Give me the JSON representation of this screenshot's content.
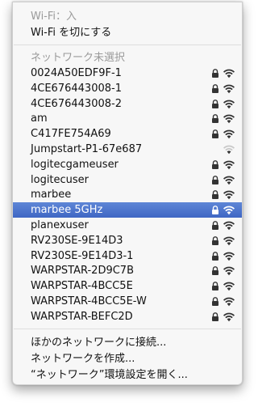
{
  "status": {
    "wifi_status": "Wi-Fi：入",
    "turn_off": "Wi-Fi を切にする"
  },
  "networks_header": "ネットワーク未選択",
  "networks": [
    {
      "name": "0024A50EDF9F-1",
      "locked": true,
      "selected": false,
      "strength": 3
    },
    {
      "name": "4CE676443008-1",
      "locked": true,
      "selected": false,
      "strength": 3
    },
    {
      "name": "4CE676443008-2",
      "locked": true,
      "selected": false,
      "strength": 3
    },
    {
      "name": "am",
      "locked": true,
      "selected": false,
      "strength": 3
    },
    {
      "name": "C417FE754A69",
      "locked": true,
      "selected": false,
      "strength": 3
    },
    {
      "name": "Jumpstart-P1-67e687",
      "locked": false,
      "selected": false,
      "strength": 1
    },
    {
      "name": "logitecgameuser",
      "locked": true,
      "selected": false,
      "strength": 3
    },
    {
      "name": "logitecuser",
      "locked": true,
      "selected": false,
      "strength": 3
    },
    {
      "name": "marbee",
      "locked": true,
      "selected": false,
      "strength": 3
    },
    {
      "name": "marbee 5GHz",
      "locked": true,
      "selected": true,
      "strength": 3
    },
    {
      "name": "planexuser",
      "locked": true,
      "selected": false,
      "strength": 3
    },
    {
      "name": "RV230SE-9E14D3",
      "locked": true,
      "selected": false,
      "strength": 3
    },
    {
      "name": "RV230SE-9E14D3-1",
      "locked": true,
      "selected": false,
      "strength": 3
    },
    {
      "name": "WARPSTAR-2D9C7B",
      "locked": true,
      "selected": false,
      "strength": 3
    },
    {
      "name": "WARPSTAR-4BCC5E",
      "locked": true,
      "selected": false,
      "strength": 3
    },
    {
      "name": "WARPSTAR-4BCC5E-W",
      "locked": true,
      "selected": false,
      "strength": 3
    },
    {
      "name": "WARPSTAR-BEFC2D",
      "locked": true,
      "selected": false,
      "strength": 3
    }
  ],
  "actions": {
    "join_other": "ほかのネットワークに接続...",
    "create_network": "ネットワークを作成...",
    "open_prefs": "“ネットワーク”環境設定を開く..."
  },
  "icons": {
    "lock": "lock-icon",
    "wifi": "wifi-icon"
  }
}
